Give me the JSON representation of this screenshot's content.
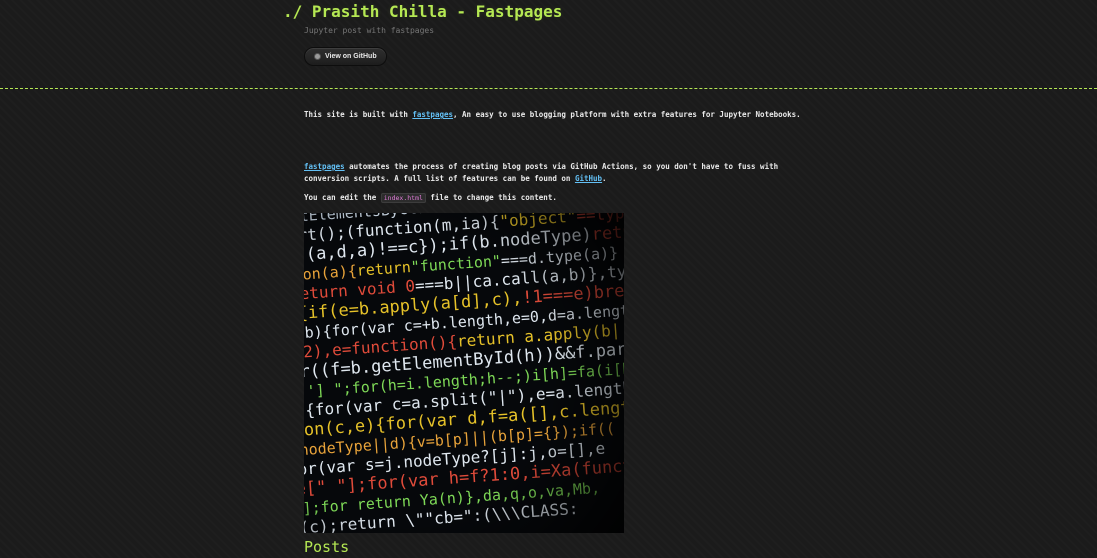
{
  "header": {
    "title": "./ Prasith Chilla - Fastpages",
    "subtitle": "Jupyter post with fastpages",
    "github_button_label": "View on GitHub"
  },
  "intro": {
    "p1_prefix": "This site is built with ",
    "p1_link": "fastpages",
    "p1_suffix": ", An easy to use blogging platform with extra features for Jupyter Notebooks.",
    "p2_link": "fastpages",
    "p2_middle": " automates the process of creating blog posts via GitHub Actions, so you don't have to fuss with conversion scripts. A full list of features can be found on ",
    "p2_link2": "GitHub",
    "p2_suffix": ".",
    "p3_prefix": "You can edit the ",
    "p3_code": "index.html",
    "p3_suffix": " file to change this content."
  },
  "image": {
    "alt": "code screenshot"
  },
  "posts": {
    "heading": "Posts"
  },
  "colors": {
    "accent": "#b5e853",
    "link": "#63c0f5",
    "background": "#1b1b1b"
  }
}
